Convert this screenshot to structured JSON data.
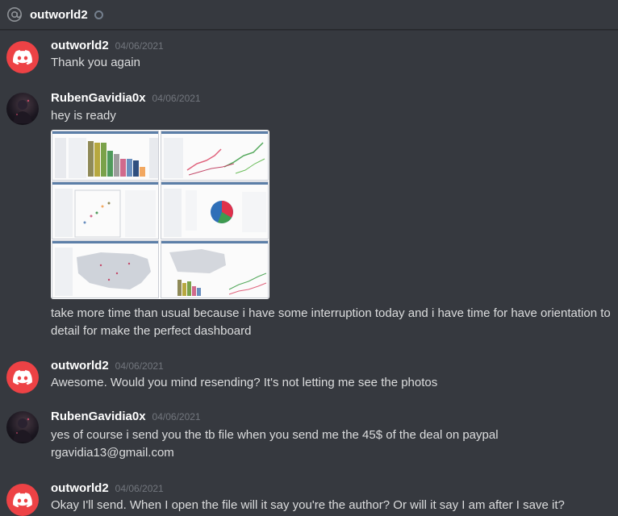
{
  "header": {
    "title": "outworld2"
  },
  "messages": [
    {
      "author": "outworld2",
      "timestamp": "04/06/2021",
      "text": "Thank you again"
    },
    {
      "author": "RubenGavidia0x",
      "timestamp": "04/06/2021",
      "text": "hey is ready",
      "text2": "take more time than usual because i have some interruption today and i have time for have orientation to detail for make the perfect dashboard"
    },
    {
      "author": "outworld2",
      "timestamp": "04/06/2021",
      "text": "Awesome. Would you mind resending? It's not letting me see the photos"
    },
    {
      "author": "RubenGavidia0x",
      "timestamp": "04/06/2021",
      "text": "yes of course i send you the tb file when you send me the 45$ of the deal on paypal",
      "text2": "rgavidia13@gmail.com"
    },
    {
      "author": "outworld2",
      "timestamp": "04/06/2021",
      "text": "Okay I'll send. When I open the file will it say you're the author? Or will it say I am after I save it?"
    }
  ],
  "colors": {
    "background": "#36393f",
    "discord_red": "#ed4245",
    "timestamp": "#72767d",
    "text": "#dcddde"
  }
}
